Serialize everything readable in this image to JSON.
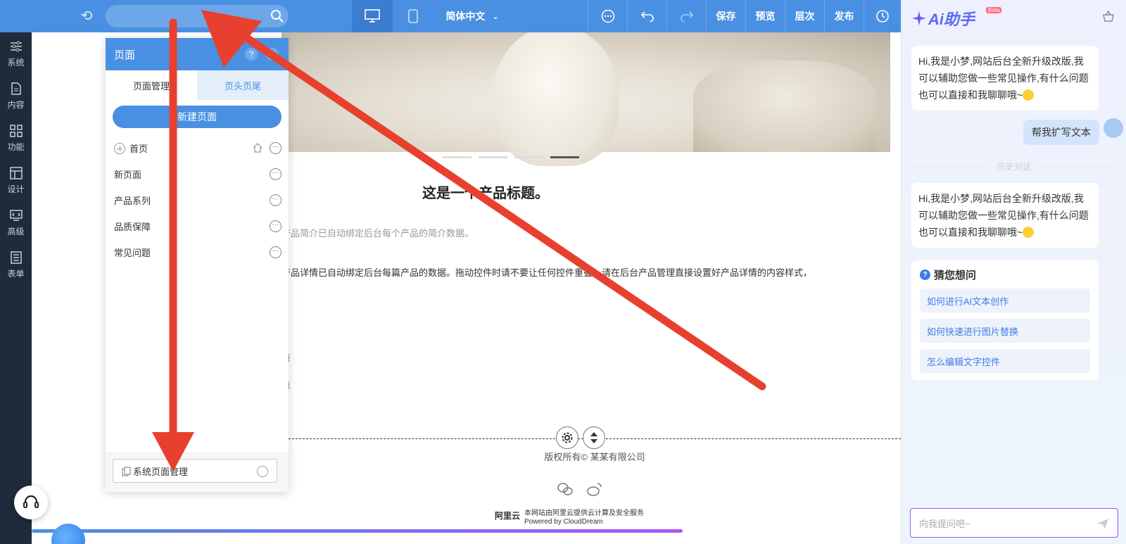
{
  "toolbar": {
    "language": "简体中文",
    "save": "保存",
    "preview": "预览",
    "layers": "层次",
    "publish": "发布"
  },
  "rail": {
    "items": [
      {
        "label": "系统",
        "icon": "sliders-icon"
      },
      {
        "label": "内容",
        "icon": "document-icon"
      },
      {
        "label": "功能",
        "icon": "grid-icon"
      },
      {
        "label": "设计",
        "icon": "layout-icon"
      },
      {
        "label": "高级",
        "icon": "code-icon"
      },
      {
        "label": "表单",
        "icon": "form-icon"
      }
    ]
  },
  "canvas": {
    "product_title": "这是一个产品标题。",
    "product_brief": "产品简介已自动绑定后台每个产品的简介数据。",
    "product_detail": "产品详情已自动绑定后台每篇产品的数据。拖动控件时请不要让任何控件重叠。请在后台产品管理直接设置好产品详情的内容样式，",
    "frag1": "题",
    "frag2": "题",
    "copyright": "版权所有© 某某有限公司",
    "aliyun_logo": "阿里云",
    "aliyun_line1": "本网站由阿里云提供云计算及安全服务",
    "aliyun_line2": "Powered by CloudDream"
  },
  "panel": {
    "title": "页面",
    "help": "?",
    "tab_manage": "页面管理",
    "tab_header_footer": "页头页尾",
    "new_page": "新建页面",
    "pages": [
      {
        "label": "首页"
      },
      {
        "label": "新页面"
      },
      {
        "label": "产品系列"
      },
      {
        "label": "品质保障"
      },
      {
        "label": "常见问题"
      }
    ],
    "system_pages": "系统页面管理"
  },
  "ai": {
    "title": "Ai助手",
    "beta": "Beta",
    "greeting": "Hi,我是小梦,网站后台全新升级改版,我可以辅助您做一些常见操作,有什么问题也可以直接和我聊聊哦~",
    "user_message": "帮我扩写文本",
    "history_label": "历史对话",
    "greeting2": "Hi,我是小梦,网站后台全新升级改版,我可以辅助您做一些常见操作,有什么问题也可以直接和我聊聊哦~",
    "guess_title": "猜您想问",
    "suggestions": [
      "如何进行AI文本创作",
      "如何快速进行图片替换",
      "怎么编辑文字控件"
    ],
    "input_placeholder": "向我提问吧~"
  },
  "colors": {
    "toolbar": "#4a90e2",
    "rail": "#1f2b3a",
    "arrow": "#e8402e",
    "accent": "#3d7ce8"
  }
}
